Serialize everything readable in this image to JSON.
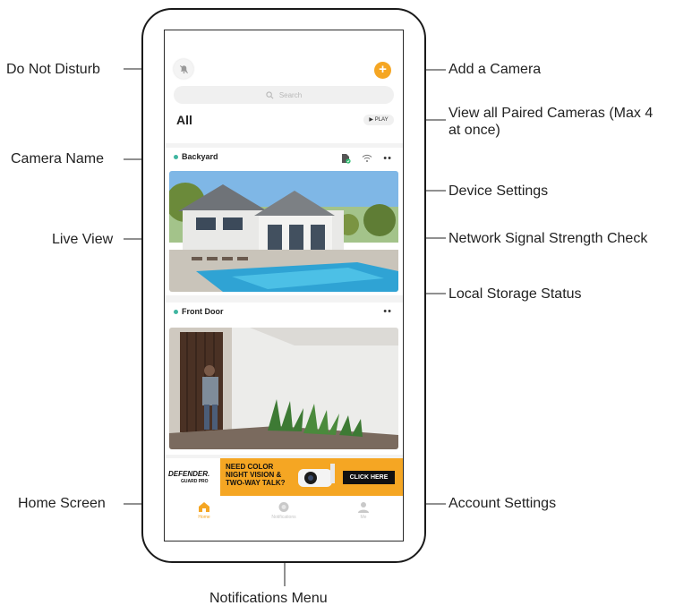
{
  "callouts": {
    "do_not_disturb": "Do Not Disturb",
    "camera_name": "Camera Name",
    "live_view": "Live View",
    "home_screen": "Home Screen",
    "add_camera": "Add a Camera",
    "view_all_paired": "View all Paired Cameras (Max 4 at once)",
    "device_settings": "Device Settings",
    "network_signal": "Network Signal Strength Check",
    "local_storage": "Local Storage Status",
    "account_settings": "Account Settings",
    "notifications_menu": "Notifications Menu"
  },
  "app": {
    "search_placeholder": "Search",
    "section_title": "All",
    "play_label": "▶ PLAY",
    "cameras": [
      {
        "name": "Backyard",
        "more": "••"
      },
      {
        "name": "Front Door",
        "more": "••"
      }
    ],
    "ad": {
      "brand": "DEFENDER.",
      "sub": "GUARD PRO",
      "text": "NEED COLOR NIGHT VISION & TWO-WAY TALK?",
      "cta": "CLICK HERE"
    },
    "tabs": [
      {
        "label": "Home",
        "icon": "home-icon"
      },
      {
        "label": "Notifications",
        "icon": "bell-icon"
      },
      {
        "label": "Me",
        "icon": "user-icon"
      }
    ]
  },
  "colors": {
    "accent": "#f5a623",
    "status_dot": "#3fb5a0",
    "storage_ok": "#2fbf71"
  }
}
